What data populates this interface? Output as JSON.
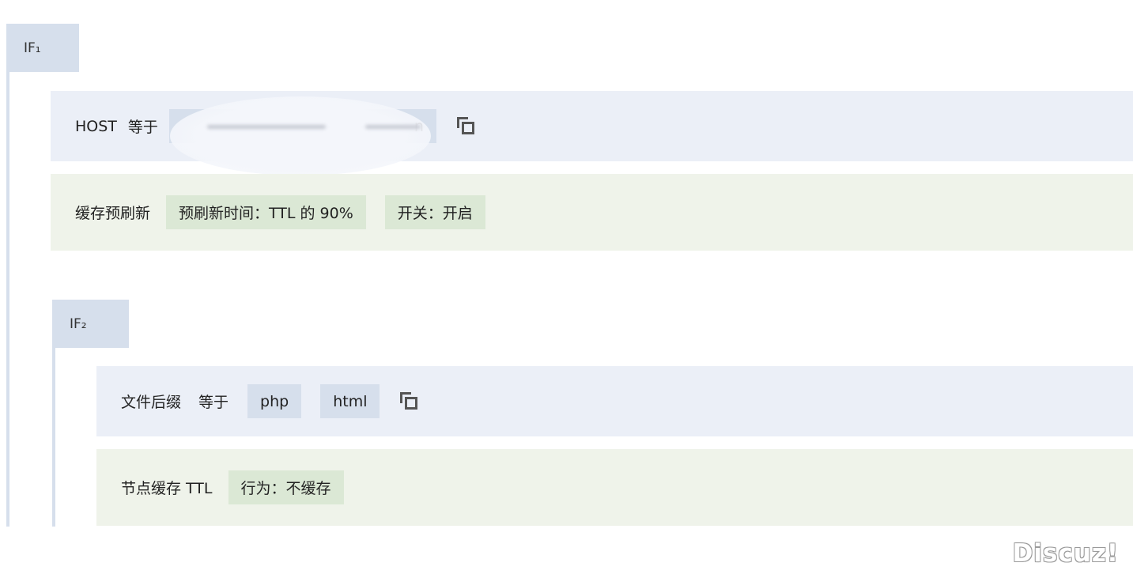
{
  "if1": {
    "tag": "IF₁",
    "condition": {
      "field": "HOST",
      "operator": "等于",
      "values_visible_suffix": "n"
    },
    "action": {
      "name": "缓存预刷新",
      "chips": [
        "预刷新时间：TTL 的 90%",
        "开关：开启"
      ]
    }
  },
  "if2": {
    "tag": "IF₂",
    "condition": {
      "field": "文件后缀",
      "operator": "等于",
      "values": [
        "php",
        "html"
      ]
    },
    "action": {
      "name": "节点缓存 TTL",
      "chips": [
        "行为：不缓存"
      ]
    }
  },
  "watermark": "Discuz!",
  "colors": {
    "tag_bg": "#d6dfec",
    "condition_bg": "#ebeff7",
    "action_bg": "#eff3ea",
    "chip_blue": "#d6dfec",
    "chip_green": "#dbe8d5"
  },
  "icons": [
    "copy-icon"
  ]
}
